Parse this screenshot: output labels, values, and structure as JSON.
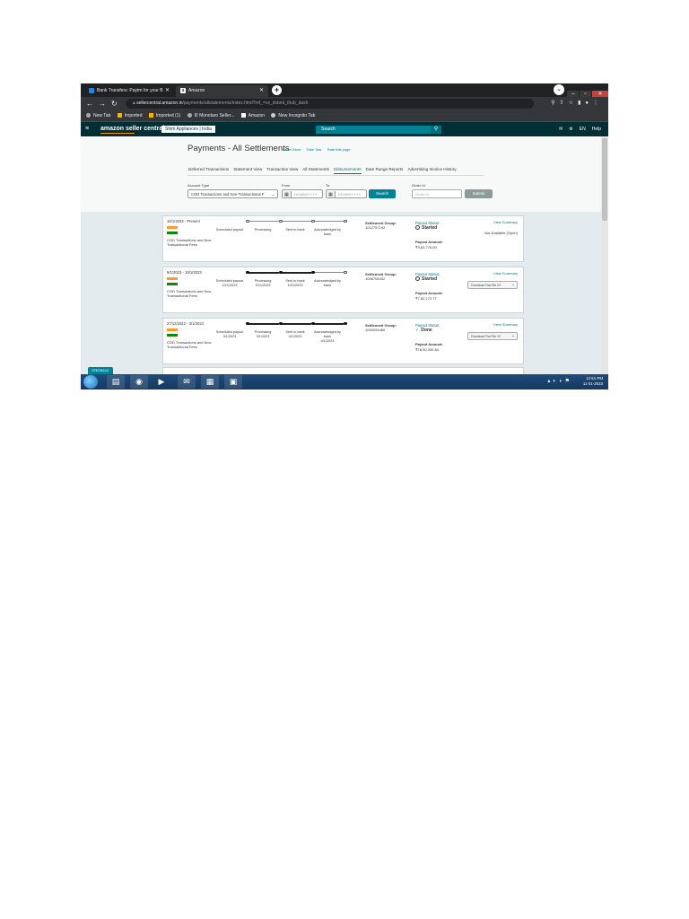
{
  "browser": {
    "tabs": [
      {
        "title": "Bank Transfers: Paytm for your B"
      },
      {
        "title": "Amazon"
      }
    ],
    "url": "sellercentral.amazon.in/payments/allstatements/index.html?ref_=xx_dsbmt_thub_dash",
    "url_host": "sellercentral.amazon.in",
    "url_path": "/payments/allstatements/index.html?ref_=xx_dsbmt_thub_dash",
    "bookmarks": [
      "New Tab",
      "Imported",
      "Imported (1)",
      "III Monotaro Seller...",
      "Amazon",
      "New Incognito Tab"
    ]
  },
  "sc_header": {
    "logo": "amazon seller central",
    "store": "Shim Appliances | India",
    "search_placeholder": "Search",
    "lang": "EN",
    "help": "Help"
  },
  "page": {
    "title": "Payments - All Settlements",
    "title_links": [
      "Learn More",
      "Take Tour",
      "Rate this page"
    ],
    "tabs": [
      "Deferred Transactions",
      "Statement View",
      "Transaction View",
      "All Statements",
      "Disbursements",
      "Date Range Reports",
      "Advertising Invoice History"
    ],
    "active_tab": "Disbursements"
  },
  "filters": {
    "account_type_label": "Account Type",
    "account_type_value": "COD Transactions and Non-Transactional F",
    "from_label": "From",
    "to_label": "To",
    "date_placeholder": "DD/MM/YYYY",
    "search_button": "Search",
    "order_id_label": "Order Id",
    "order_id_placeholder": "Order Id",
    "submit_button": "Submit"
  },
  "steps": [
    "Scheduled payout",
    "Processing",
    "Sent to bank",
    "Acknowledged by bank"
  ],
  "settlements": [
    {
      "period": "10/1/2023 - Present",
      "account": "COD Transactions and Non-Transactional Fees",
      "step_dates": [
        "",
        "",
        "",
        ""
      ],
      "completed_steps": 0,
      "group_label": "Settlement Group:",
      "group_id": "1012757192",
      "status_label": "Payout Status:",
      "status": "Started",
      "amount_label": "Payout Amount:",
      "amount": "₹9,63,776.00",
      "view_summary": "View Summary",
      "right_text": "Not Available (Open)"
    },
    {
      "period": "9/1/2023 - 10/1/2023",
      "account": "COD Transactions and Non-Transactional Fees",
      "step_dates": [
        "10/1/2023",
        "10/1/2023",
        "10/1/2023",
        ""
      ],
      "completed_steps": 3,
      "group_label": "Settlement Group:",
      "group_id": "1006706432",
      "status_label": "Payout Status:",
      "status": "Started",
      "amount_label": "Payout Amount:",
      "amount": "₹7,82,172.77",
      "view_summary": "View Summary",
      "right_text": "Download Flat File V2"
    },
    {
      "period": "27/12/2022 - 3/1/2023",
      "account": "COD Transactions and Non-Transactional Fees",
      "step_dates": [
        "3/1/2023",
        "3/1/2023",
        "4/1/2023",
        "4/1/2023"
      ],
      "completed_steps": 4,
      "group_label": "Settlement Group:",
      "group_id": "1000094460",
      "status_label": "Payout Status:",
      "status": "Done",
      "amount_label": "Payout Amount:",
      "amount": "₹78,50,330.84",
      "view_summary": "View Summary",
      "right_text": "Download Flat File V2"
    }
  ],
  "feedback_tab": "FEEDBACK",
  "taskbar": {
    "time": "12:51 PM",
    "date": "11-01-2023"
  }
}
